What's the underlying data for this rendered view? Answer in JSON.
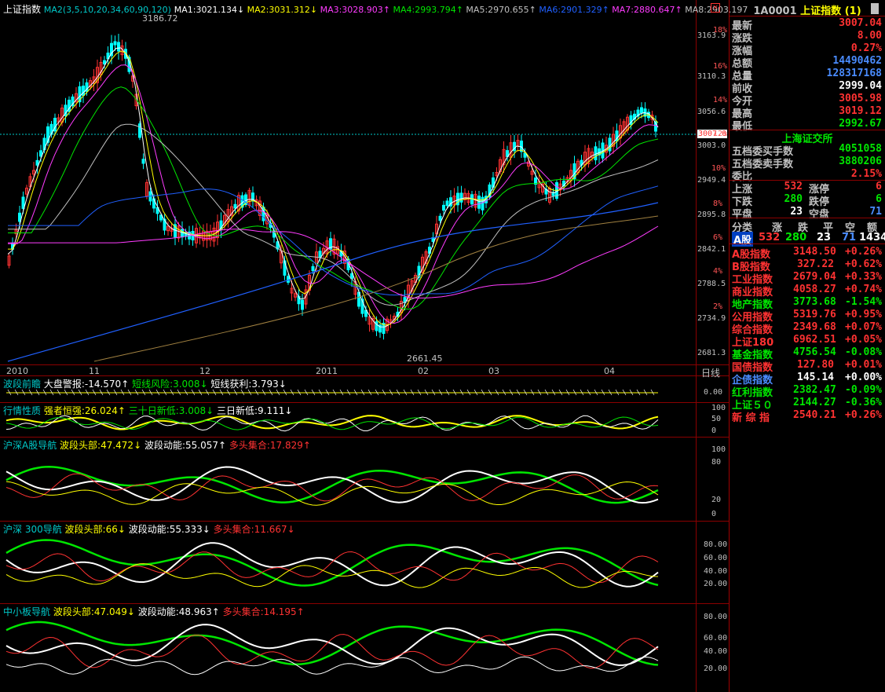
{
  "main_chart": {
    "title": "上证指数",
    "ma_params": "MA2(3,5,10,20,34,60,90,120)",
    "ma_values": [
      {
        "label": "MA1:3021.134↓",
        "color": "#ffffff"
      },
      {
        "label": "MA2:3031.312↓",
        "color": "#ffff00"
      },
      {
        "label": "MA3:3028.903↑",
        "color": "#ff3cff"
      },
      {
        "label": "MA4:2993.794↑",
        "color": "#00e600"
      },
      {
        "label": "MA5:2970.655↑",
        "color": "#c0c0c0"
      },
      {
        "label": "MA6:2901.329↑",
        "color": "#2060ff"
      },
      {
        "label": "MA7:2880.647↑",
        "color": "#ff3cff"
      },
      {
        "label": "MA8:2903.197",
        "color": "#c0c0c0"
      }
    ],
    "high_label": "3186.72",
    "low_label": "2661.45",
    "current_price_tag": "3007.0",
    "price_scale": [
      "3163.9",
      "3110.3",
      "3056.6",
      "3003.0",
      "2949.4",
      "2895.8",
      "2842.1",
      "2788.5",
      "2734.9",
      "2681.3"
    ],
    "pct_scale": [
      "18%",
      "16%",
      "14%",
      "12%",
      "10%",
      "8%",
      "6%",
      "4%",
      "2%"
    ],
    "x_labels": [
      "2010",
      "11",
      "12",
      "2011",
      "02",
      "03",
      "04"
    ],
    "period": "日线"
  },
  "panes": [
    {
      "segments": [
        {
          "text": "波段前瞻",
          "color": "#00c8c8"
        },
        {
          "text": "大盘警报:-14.570↑",
          "color": "#ffffff"
        },
        {
          "text": "短线风险:3.008↓",
          "color": "#00e600"
        },
        {
          "text": "短线获利:3.793↓",
          "color": "#ffffff"
        }
      ],
      "scale": [
        "0.00"
      ]
    },
    {
      "segments": [
        {
          "text": "行情性质",
          "color": "#00c8c8"
        },
        {
          "text": "强者恒强:26.024↑",
          "color": "#ffff00"
        },
        {
          "text": "三十日新低:3.008↓",
          "color": "#00e600"
        },
        {
          "text": "三日新低:9.111↓",
          "color": "#ffffff"
        }
      ],
      "scale": [
        "100",
        "50",
        "0"
      ]
    },
    {
      "segments": [
        {
          "text": "沪深A股导航",
          "color": "#00c8c8"
        },
        {
          "text": "波段头部:47.472↓",
          "color": "#ffff00"
        },
        {
          "text": "波段动能:55.057↑",
          "color": "#ffffff"
        },
        {
          "text": "多头集合:17.829↑",
          "color": "#ff3232"
        }
      ],
      "scale": [
        "100",
        "80",
        "20",
        "0"
      ]
    },
    {
      "segments": [
        {
          "text": "沪深 300导航",
          "color": "#00c8c8"
        },
        {
          "text": "波段头部:66↓",
          "color": "#ffff00"
        },
        {
          "text": "波段动能:55.333↓",
          "color": "#ffffff"
        },
        {
          "text": "多头集合:11.667↓",
          "color": "#ff3232"
        }
      ],
      "scale": [
        "80.00",
        "60.00",
        "40.00",
        "20.00"
      ]
    },
    {
      "segments": [
        {
          "text": "中小板导航",
          "color": "#00c8c8"
        },
        {
          "text": "波段头部:47.049↓",
          "color": "#ffff00"
        },
        {
          "text": "波段动能:48.963↑",
          "color": "#ffffff"
        },
        {
          "text": "多头集合:14.195↑",
          "color": "#ff3232"
        }
      ],
      "scale": [
        "80.00",
        "60.00",
        "40.00",
        "20.00"
      ]
    }
  ],
  "quote": {
    "code": "1A0001",
    "name": "上证指数",
    "tag": "(1)",
    "rows": [
      {
        "k": "最新",
        "v": "3007.04",
        "color": "#ff3232"
      },
      {
        "k": "涨跌",
        "v": "8.00",
        "color": "#ff3232"
      },
      {
        "k": "涨幅",
        "v": "0.27%",
        "color": "#ff3232"
      },
      {
        "k": "总额",
        "v": "14490462",
        "color": "#4a8cff"
      },
      {
        "k": "总量",
        "v": "128317168",
        "color": "#4a8cff"
      },
      {
        "k": "前收",
        "v": "2999.04",
        "color": "#ffffff"
      },
      {
        "k": "今开",
        "v": "3005.98",
        "color": "#ff3232"
      },
      {
        "k": "最高",
        "v": "3019.12",
        "color": "#ff3232"
      },
      {
        "k": "最低",
        "v": "2992.67",
        "color": "#00e600"
      }
    ],
    "exchange": "上海证交所",
    "rows2": [
      {
        "k": "五档委买手数",
        "v": "4051058",
        "color": "#00e600"
      },
      {
        "k": "五档委卖手数",
        "v": "3880206",
        "color": "#00e600"
      },
      {
        "k": "委比",
        "v": "2.15%",
        "color": "#ff3232"
      }
    ],
    "breadth": [
      {
        "k1": "上涨",
        "v1": "532",
        "c1": "#ff3232",
        "k2": "涨停",
        "v2": "6",
        "c2": "#ff3232"
      },
      {
        "k1": "下跌",
        "v1": "280",
        "c1": "#00e600",
        "k2": "跌停",
        "v2": "6",
        "c2": "#00e600"
      },
      {
        "k1": "平盘",
        "v1": "23",
        "c1": "#ffffff",
        "k2": "空盘",
        "v2": "71",
        "c2": "#4a8cff"
      }
    ],
    "cls_header": [
      "分类",
      "涨",
      "跌",
      "平",
      "空",
      "额"
    ],
    "cls_row": {
      "name": "A股",
      "up": "532",
      "down": "280",
      "flat": "23",
      "empty": "71",
      "total": "1434"
    },
    "indices": [
      {
        "n": "A股指数",
        "p": "3148.50",
        "c": "+0.26%",
        "nc": "#ff3232",
        "pc": "#ff3232"
      },
      {
        "n": "B股指数",
        "p": "327.22",
        "c": "+0.62%",
        "nc": "#ff3232",
        "pc": "#ff3232"
      },
      {
        "n": "工业指数",
        "p": "2679.04",
        "c": "+0.33%",
        "nc": "#ff3232",
        "pc": "#ff3232"
      },
      {
        "n": "商业指数",
        "p": "4058.27",
        "c": "+0.74%",
        "nc": "#ff3232",
        "pc": "#ff3232"
      },
      {
        "n": "地产指数",
        "p": "3773.68",
        "c": "-1.54%",
        "nc": "#00e600",
        "pc": "#00e600"
      },
      {
        "n": "公用指数",
        "p": "5319.76",
        "c": "+0.95%",
        "nc": "#ff3232",
        "pc": "#ff3232"
      },
      {
        "n": "综合指数",
        "p": "2349.68",
        "c": "+0.07%",
        "nc": "#ff3232",
        "pc": "#ff3232"
      },
      {
        "n": "上证180",
        "p": "6962.51",
        "c": "+0.05%",
        "nc": "#ff3232",
        "pc": "#ff3232"
      },
      {
        "n": "基金指数",
        "p": "4756.54",
        "c": "-0.08%",
        "nc": "#00e600",
        "pc": "#00e600"
      },
      {
        "n": "国债指数",
        "p": "127.80",
        "c": "+0.01%",
        "nc": "#ff3232",
        "pc": "#ff3232"
      },
      {
        "n": "企债指数",
        "p": "145.14",
        "c": "+0.00%",
        "nc": "#4a8cff",
        "pc": "#ffffff"
      },
      {
        "n": "红利指数",
        "p": "2382.47",
        "c": "-0.09%",
        "nc": "#00e600",
        "pc": "#00e600"
      },
      {
        "n": "上证５０",
        "p": "2144.27",
        "c": "-0.36%",
        "nc": "#00e600",
        "pc": "#00e600"
      },
      {
        "n": "新 综 指",
        "p": "2540.21",
        "c": "+0.26%",
        "nc": "#ff3232",
        "pc": "#ff3232"
      }
    ]
  }
}
